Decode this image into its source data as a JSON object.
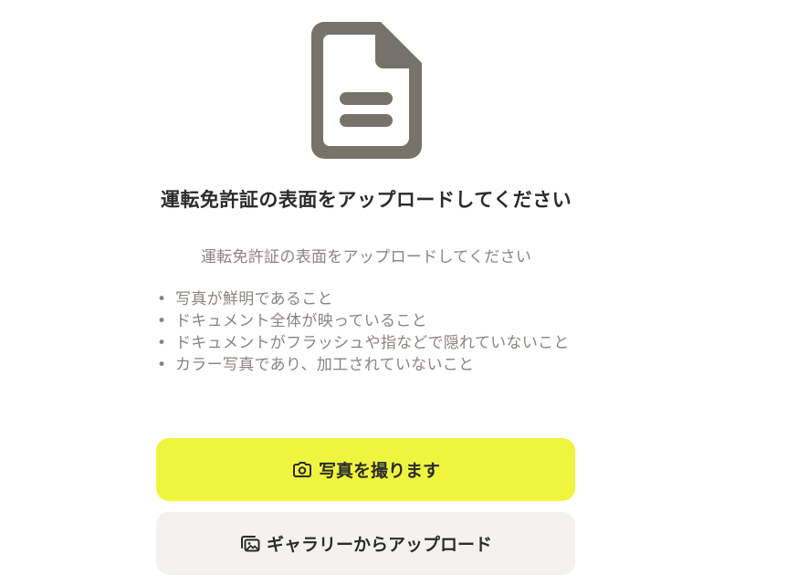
{
  "doc_icon": "document-icon",
  "title": "運転免許証の表面をアップロードしてください",
  "subtitle": "運転免許証の表面をアップロードしてください",
  "requirements": [
    "写真が鮮明であること",
    "ドキュメント全体が映っていること",
    "ドキュメントがフラッシュや指などで隠れていないこと",
    "カラー写真であり、加工されていないこと"
  ],
  "bullet": "•",
  "buttons": {
    "take_photo": {
      "label": "写真を撮ります",
      "icon": "camera-icon"
    },
    "upload_gallery": {
      "label": "ギャラリーからアップロード",
      "icon": "gallery-icon"
    }
  },
  "colors": {
    "primary_button": "#eff53e",
    "secondary_button": "#f3f2ee",
    "icon": "#77736b",
    "text": "#2b2b2b",
    "muted_text": "#8a857d"
  }
}
